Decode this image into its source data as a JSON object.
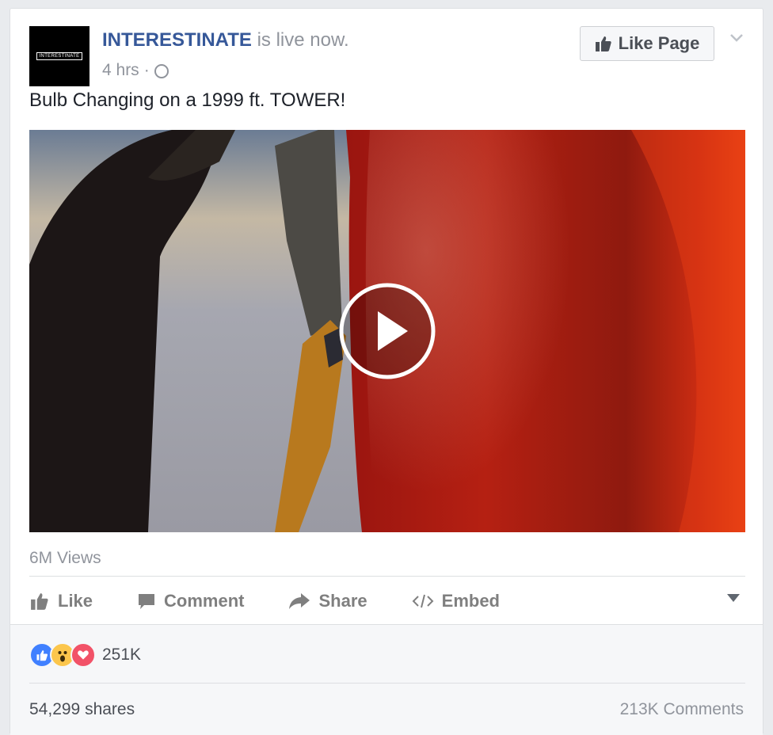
{
  "post": {
    "page_name": "INTERESTINATE",
    "status": " is live now.",
    "avatar_logo_text": "INTERESTINATE",
    "time": "4 hrs",
    "separator": "·",
    "privacy_icon": "globe-icon",
    "like_page_label": "Like Page",
    "text": "Bulb Changing on a 1999 ft. TOWER!"
  },
  "video": {
    "views": "6M Views"
  },
  "actions": {
    "like": "Like",
    "comment": "Comment",
    "share": "Share",
    "embed": "Embed"
  },
  "stats": {
    "reactions_count": "251K",
    "reaction_icons": [
      "like-reaction-icon",
      "wow-reaction-icon",
      "love-reaction-icon"
    ],
    "shares": "54,299 shares",
    "comments": "213K Comments"
  },
  "colors": {
    "link": "#365899",
    "like_blue": "#4080ff",
    "love_red": "#f25268",
    "wow_yellow": "#fcc64c"
  }
}
